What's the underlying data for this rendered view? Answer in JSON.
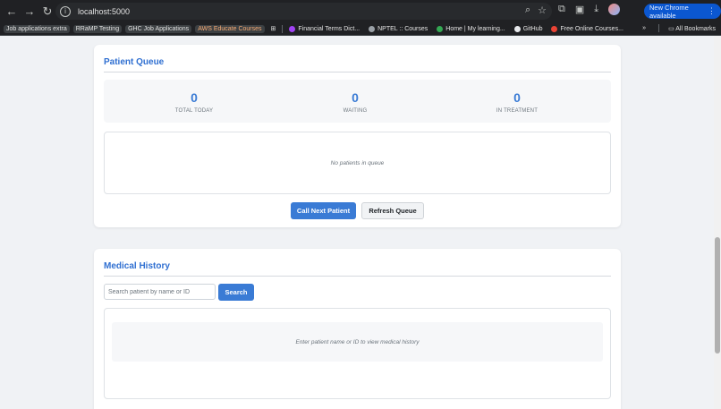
{
  "browser": {
    "url": "localhost:5000",
    "update_label": "New Chrome available",
    "bookmarks": [
      {
        "label": "Job applications extra"
      },
      {
        "label": "RRaMP Testing"
      },
      {
        "label": "GHC Job Applications"
      },
      {
        "label": "AWS Educate Courses"
      },
      {
        "label": "Financial Terms Dict..."
      },
      {
        "label": "NPTEL :: Courses"
      },
      {
        "label": "Home | My learning..."
      },
      {
        "label": "GitHub"
      },
      {
        "label": "Free Online Courses..."
      }
    ],
    "all_bookmarks_label": "All Bookmarks",
    "overflow_label": "»"
  },
  "queue": {
    "title": "Patient Queue",
    "stats": [
      {
        "value": "0",
        "label": "TOTAL TODAY"
      },
      {
        "value": "0",
        "label": "WAITING"
      },
      {
        "value": "0",
        "label": "IN TREATMENT"
      }
    ],
    "empty_message": "No patients in queue",
    "call_next_label": "Call Next Patient",
    "refresh_label": "Refresh Queue"
  },
  "history": {
    "title": "Medical History",
    "search_placeholder": "Search patient by name or ID",
    "search_button_label": "Search",
    "empty_message": "Enter patient name or ID to view medical history"
  },
  "colors": {
    "accent": "#3a7bd5",
    "title": "#2f6fd1",
    "page_bg": "#f0f2f5"
  },
  "icons": [
    "back-arrow-icon",
    "forward-arrow-icon",
    "reload-icon",
    "site-info-icon",
    "zoom-icon",
    "star-icon",
    "extensions-icon",
    "media-icon",
    "download-icon",
    "profile-avatar",
    "apps-grid-icon",
    "folder-icon",
    "menu-dots-icon"
  ]
}
